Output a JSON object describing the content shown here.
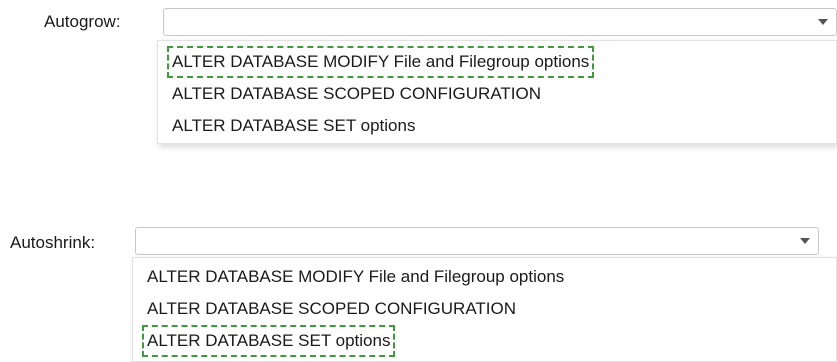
{
  "autogrow": {
    "label": "Autogrow:",
    "selected_value": "",
    "options": [
      {
        "label": "ALTER DATABASE MODIFY File and Filegroup options",
        "highlighted": true
      },
      {
        "label": "ALTER DATABASE SCOPED CONFIGURATION",
        "highlighted": false
      },
      {
        "label": "ALTER DATABASE SET options",
        "highlighted": false
      }
    ]
  },
  "autoshrink": {
    "label": "Autoshrink:",
    "selected_value": "",
    "options": [
      {
        "label": "ALTER DATABASE MODIFY File and Filegroup options",
        "highlighted": false
      },
      {
        "label": "ALTER DATABASE SCOPED CONFIGURATION",
        "highlighted": false
      },
      {
        "label": "ALTER DATABASE SET options",
        "highlighted": true
      }
    ]
  },
  "colors": {
    "highlight_border": "#3d9a3d",
    "select_border": "#c8c8c8"
  },
  "icons": {
    "dropdown_arrow": "chevron-down-icon"
  }
}
